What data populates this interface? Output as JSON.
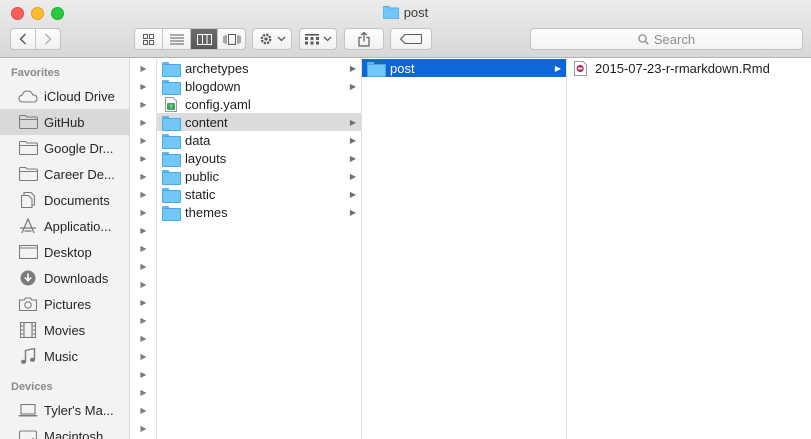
{
  "window": {
    "title": "post"
  },
  "toolbar": {
    "back_icon": "chevron-left-icon",
    "forward_icon": "chevron-right-icon",
    "view_modes": [
      "icon-view-icon",
      "list-view-icon",
      "column-view-icon",
      "coverflow-view-icon"
    ],
    "active_view": "column-view-icon",
    "search_placeholder": "Search"
  },
  "sidebar": {
    "favorites_heading": "Favorites",
    "favorites": [
      {
        "label": "iCloud Drive",
        "icon": "cloud-icon"
      },
      {
        "label": "GitHub",
        "icon": "folder-icon",
        "selected": true
      },
      {
        "label": "Google Dr...",
        "icon": "folder-icon"
      },
      {
        "label": "Career De...",
        "icon": "folder-icon"
      },
      {
        "label": "Documents",
        "icon": "documents-icon"
      },
      {
        "label": "Applicatio...",
        "icon": "applications-icon"
      },
      {
        "label": "Desktop",
        "icon": "desktop-icon"
      },
      {
        "label": "Downloads",
        "icon": "downloads-icon"
      },
      {
        "label": "Pictures",
        "icon": "camera-icon"
      },
      {
        "label": "Movies",
        "icon": "film-icon"
      },
      {
        "label": "Music",
        "icon": "music-note-icon"
      }
    ],
    "devices_heading": "Devices",
    "devices": [
      {
        "label": "Tyler's Ma...",
        "icon": "laptop-icon"
      },
      {
        "label": "Macintosh...",
        "icon": "hard-drive-icon"
      }
    ]
  },
  "columns": {
    "column2": [
      {
        "name": "archetypes",
        "type": "folder"
      },
      {
        "name": "blogdown",
        "type": "folder"
      },
      {
        "name": "config.yaml",
        "type": "yaml"
      },
      {
        "name": "content",
        "type": "folder",
        "selected": true
      },
      {
        "name": "data",
        "type": "folder"
      },
      {
        "name": "layouts",
        "type": "folder"
      },
      {
        "name": "public",
        "type": "folder"
      },
      {
        "name": "static",
        "type": "folder"
      },
      {
        "name": "themes",
        "type": "folder"
      }
    ],
    "column3": [
      {
        "name": "post",
        "type": "folder",
        "active": true
      }
    ],
    "column4": [
      {
        "name": "2015-07-23-r-rmarkdown.Rmd",
        "type": "rmd"
      }
    ]
  },
  "colors": {
    "selection_active": "#0f66d9",
    "selection_inactive": "#dcdcdc",
    "folder": "#73c7f8"
  }
}
